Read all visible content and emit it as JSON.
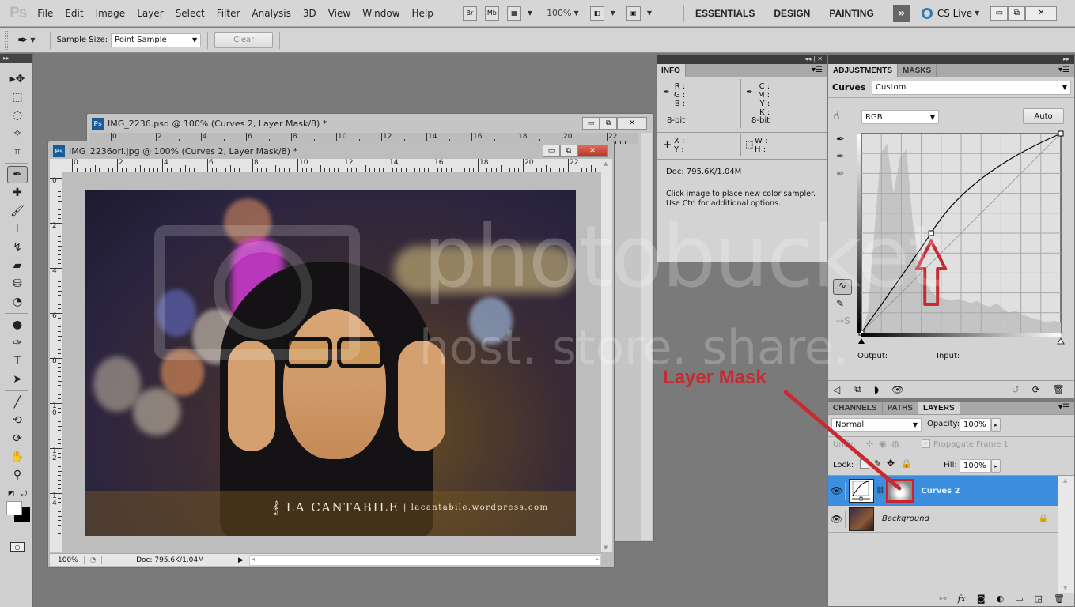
{
  "app": {
    "logo": "Ps",
    "menu": [
      "File",
      "Edit",
      "Image",
      "Layer",
      "Select",
      "Filter",
      "Analysis",
      "3D",
      "View",
      "Window",
      "Help"
    ],
    "appbar_icons": {
      "bridge": "Br",
      "minibridge": "Mb"
    },
    "zoom": "100%",
    "workspaces": [
      "ESSENTIALS",
      "DESIGN",
      "PAINTING"
    ],
    "more": "»",
    "cs_live": "CS Live"
  },
  "options": {
    "sample_size_label": "Sample Size:",
    "sample_size_value": "Point Sample",
    "clear_label": "Clear"
  },
  "tools": [
    "move",
    "marquee",
    "lasso",
    "quick-select",
    "crop",
    "eyedropper",
    "healing-brush",
    "brush",
    "clone-stamp",
    "history-brush",
    "eraser",
    "paint-bucket",
    "dodge",
    "burn",
    "pen",
    "type",
    "path-select",
    "line",
    "3d-rotate",
    "3d-orbit",
    "hand",
    "zoom"
  ],
  "documents": [
    {
      "title": "IMG_2236.psd @ 100% (Curves 2, Layer Mask/8) *",
      "ruler": [
        "0",
        "2",
        "4",
        "6",
        "8",
        "10",
        "12",
        "14",
        "16",
        "18",
        "20",
        "22"
      ]
    },
    {
      "title": "IMG_2236ori.jpg @ 100% (Curves 2, Layer Mask/8) *",
      "ruler": [
        "0",
        "2",
        "4",
        "6",
        "8",
        "10",
        "12",
        "14",
        "16",
        "18",
        "20",
        "22"
      ],
      "vruler": [
        "0",
        "2",
        "4",
        "6",
        "8",
        "10",
        "12",
        "14"
      ],
      "zoom": "100%",
      "doc_info": "Doc: 795.6K/1.04M",
      "watermark_brand": "LA CANTABILE",
      "watermark_url": "lacantabile.wordpress.com"
    }
  ],
  "info_panel": {
    "tab": "INFO",
    "rgb": [
      "R :",
      "G :",
      "B :"
    ],
    "cmyk": [
      "C :",
      "M :",
      "Y :",
      "K :"
    ],
    "bit_left": "8-bit",
    "bit_right": "8-bit",
    "xy": [
      "X :",
      "Y :"
    ],
    "wh": [
      "W :",
      "H :"
    ],
    "doc": "Doc: 795.6K/1.04M",
    "hint1": "Click image to place new color sampler.",
    "hint2": "Use Ctrl for additional options."
  },
  "adjustments": {
    "tabs": [
      "ADJUSTMENTS",
      "MASKS"
    ],
    "type_label": "Curves",
    "preset": "Custom",
    "channel": "RGB",
    "auto": "Auto",
    "output_label": "Output:",
    "input_label": "Input:",
    "curve_points": [
      [
        0,
        0
      ],
      [
        0.35,
        0.5
      ],
      [
        1,
        1
      ]
    ]
  },
  "layers_panel": {
    "tabs": [
      "CHANNELS",
      "PATHS",
      "LAYERS"
    ],
    "blend_mode": "Normal",
    "opacity_label": "Opacity:",
    "opacity": "100%",
    "unify_label": "Unify:",
    "propagate": "Propagate Frame 1",
    "lock_label": "Lock:",
    "fill_label": "Fill:",
    "fill": "100%",
    "layers": [
      {
        "name": "Curves 2",
        "selected": true
      },
      {
        "name": "Background",
        "selected": false,
        "locked": true
      }
    ]
  },
  "annotation": {
    "label": "Layer Mask",
    "color": "#c62b34"
  },
  "watermark": {
    "line1": "photobucket",
    "line2": "host. store. share."
  }
}
